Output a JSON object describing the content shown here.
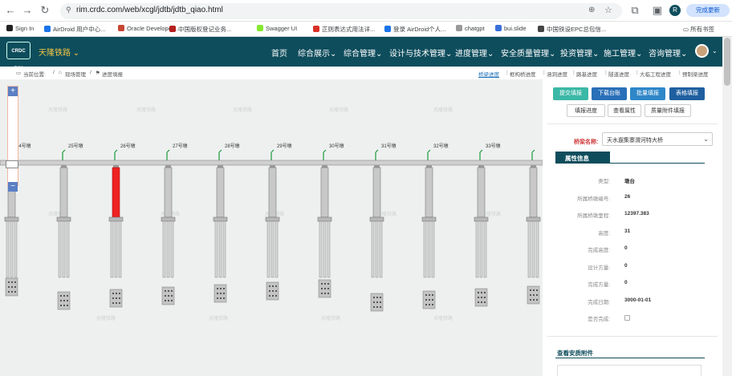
{
  "browser": {
    "url": "rim.crdc.com/web/xcgl/jdtb/jdtb_qiao.html",
    "update_label": "完成更新",
    "profile_initial": "R"
  },
  "bookmarks": [
    {
      "label": "Sign In",
      "color": "#222"
    },
    {
      "label": "AirDroid 用户中心...",
      "color": "#1a73e8"
    },
    {
      "label": "Oracle Developer...",
      "color": "#c74634"
    },
    {
      "label": "中国版权登记业务...",
      "color": "#b41e1e"
    },
    {
      "label": "Swagger UI",
      "color": "#85ea2d"
    },
    {
      "label": "正则表达式用法详...",
      "color": "#d93025"
    },
    {
      "label": "登录 AirDroid个人...",
      "color": "#1a73e8"
    },
    {
      "label": "chatgpt",
      "color": "#999"
    },
    {
      "label": "bui.slide",
      "color": "#3a6fd8"
    },
    {
      "label": "中国铁设EPC总包信...",
      "color": "#444"
    }
  ],
  "bookmarks_all": "所有书签",
  "nav": {
    "logo": "CRDC RIM",
    "brand": "天隆铁路",
    "items": [
      "首页",
      "综合展示",
      "综合管理",
      "设计与技术管理",
      "进度管理",
      "安全质量管理",
      "投资管理",
      "施工管理",
      "咨询管理"
    ]
  },
  "breadcrumb": {
    "prefix": "当前位置:",
    "path": [
      "现场管理",
      "进度填报"
    ]
  },
  "top_tabs": [
    "桥梁进度",
    "框构桥进度",
    "涵洞进度",
    "路基进度",
    "隧道进度",
    "大临工程进度",
    "预制梁进度"
  ],
  "buttons": {
    "submit": "提交填报",
    "download": "下载台账",
    "batch": "批量填报",
    "table": "表格填报",
    "fill": "填报进度",
    "view": "查看属性",
    "quality": "质量附件填报"
  },
  "bridge": {
    "label": "桥梁名称:",
    "value": "天水遛集寨渭河特大桥"
  },
  "attr_title": "属性信息",
  "attributes": [
    {
      "label": "类型:",
      "value": "墩台"
    },
    {
      "label": "所属桥墩编号:",
      "value": "26"
    },
    {
      "label": "所属桥墩里程:",
      "value": "12397.383"
    },
    {
      "label": "高度:",
      "value": "31"
    },
    {
      "label": "完成高度:",
      "value": "0"
    },
    {
      "label": "设计方量:",
      "value": "0"
    },
    {
      "label": "完成方量:",
      "value": "0"
    },
    {
      "label": "完成日期:",
      "value": "3000-01-01"
    },
    {
      "label": "是否完成:",
      "value": ""
    }
  ],
  "attachments_title": "查看安质附件",
  "piers": [
    {
      "label": "24号墩",
      "selected": false
    },
    {
      "label": "25号墩",
      "selected": false
    },
    {
      "label": "26号墩",
      "selected": true
    },
    {
      "label": "27号墩",
      "selected": false
    },
    {
      "label": "28号墩",
      "selected": false
    },
    {
      "label": "29号墩",
      "selected": false
    },
    {
      "label": "30号墩",
      "selected": false
    },
    {
      "label": "31号墩",
      "selected": false
    },
    {
      "label": "32号墩",
      "selected": false
    },
    {
      "label": "33号墩",
      "selected": false
    },
    {
      "label": "",
      "selected": false
    }
  ],
  "watermark": "天隆铁路",
  "colors": {
    "nav": "#0e4d5c",
    "selected": "#ee2222",
    "teal_btn": "#3bb8a6",
    "blue_btn": "#2a6fb8"
  }
}
